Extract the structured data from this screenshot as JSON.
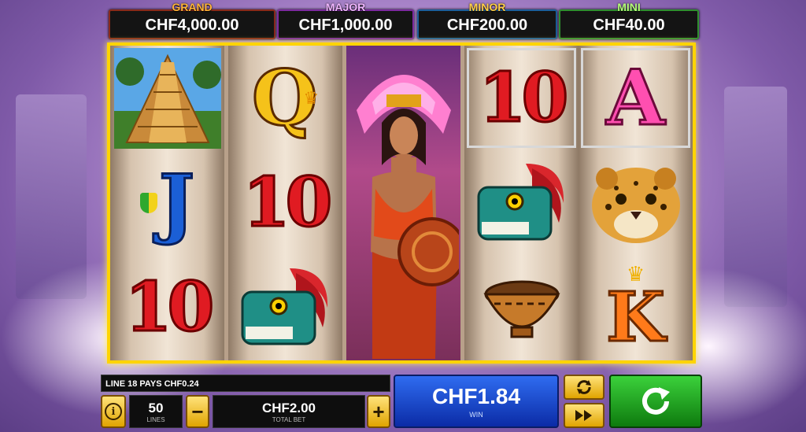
{
  "jackpots": [
    {
      "label": "GRAND",
      "value": "CHF4,000.00"
    },
    {
      "label": "MAJOR",
      "value": "CHF1,000.00"
    },
    {
      "label": "MINOR",
      "value": "CHF200.00"
    },
    {
      "label": "MINI",
      "value": "CHF40.00"
    }
  ],
  "reels": [
    [
      "pyramid",
      "J",
      "10"
    ],
    [
      "Q",
      "10",
      "serpent-head"
    ],
    [
      "warrior-woman",
      "warrior-woman",
      "warrior-woman"
    ],
    [
      "10",
      "serpent-head",
      "bowl"
    ],
    [
      "A",
      "jaguar",
      "K"
    ]
  ],
  "symbol_text": {
    "J": "J",
    "Q": "Q",
    "A": "A",
    "K": "K",
    "ten": "10"
  },
  "message": "LINE 18 PAYS CHF0.24",
  "lines": {
    "value": "50",
    "label": "LINES"
  },
  "total_bet": {
    "value": "CHF2.00",
    "label": "TOTAL BET",
    "minus": "−",
    "plus": "+"
  },
  "win": {
    "value": "CHF1.84",
    "label": "WIN"
  },
  "colors": {
    "frame": "#ffd400",
    "spin": "#1aa51a",
    "win": "#1b4ad0"
  }
}
